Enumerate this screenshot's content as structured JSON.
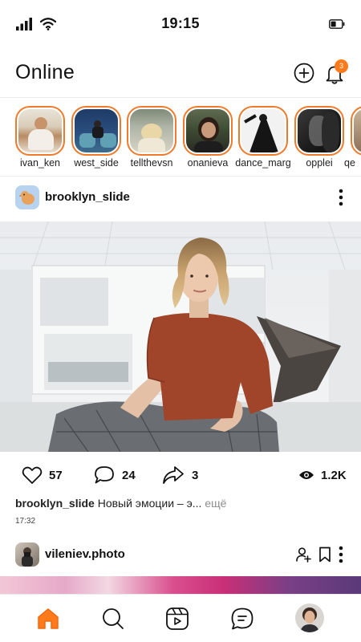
{
  "status_bar": {
    "time": "19:15"
  },
  "header": {
    "title": "Online",
    "notification_count": "3"
  },
  "stories": [
    {
      "username": "ivan_ken"
    },
    {
      "username": "west_side"
    },
    {
      "username": "tellthevsn"
    },
    {
      "username": "onanieva"
    },
    {
      "username": "dance_marg"
    },
    {
      "username": "opplei"
    },
    {
      "username": "qe"
    }
  ],
  "post1": {
    "username": "brooklyn_slide",
    "likes": "57",
    "comments": "24",
    "shares": "3",
    "views": "1.2K",
    "caption_user": "brooklyn_slide",
    "caption_text": "Новый эмоции – э...",
    "caption_more": "ещё",
    "time": "17:32"
  },
  "post2": {
    "username": "vileniev.photo"
  },
  "nav": {
    "home": "home-icon",
    "search": "search-icon",
    "reels": "reels-icon",
    "messages": "messages-icon",
    "profile": "avatar"
  },
  "colors": {
    "accent": "#f07a2a",
    "badge": "#ff7a1a"
  }
}
